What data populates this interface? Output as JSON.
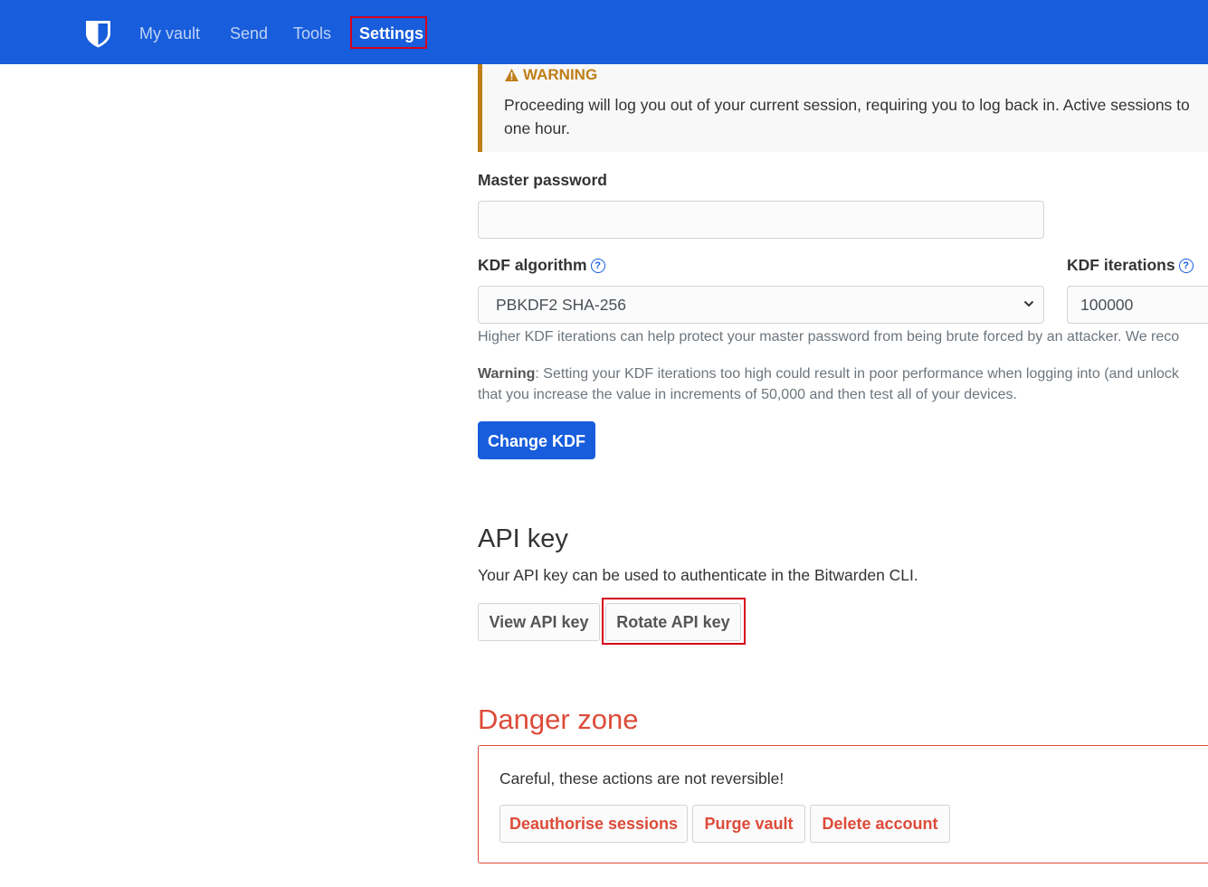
{
  "nav": {
    "items": [
      {
        "label": "My vault"
      },
      {
        "label": "Send"
      },
      {
        "label": "Tools"
      },
      {
        "label": "Settings",
        "active": true
      }
    ]
  },
  "warning": {
    "title": "WARNING",
    "text": "Proceeding will log you out of your current session, requiring you to log back in. Active sessions to one hour."
  },
  "master_password": {
    "label": "Master password",
    "value": ""
  },
  "kdf": {
    "algorithm_label": "KDF algorithm",
    "algorithm_value": "PBKDF2 SHA-256",
    "iterations_label": "KDF iterations",
    "iterations_value": "100000",
    "help_line": "Higher KDF iterations can help protect your master password from being brute forced by an attacker. We reco",
    "warning_label": "Warning",
    "warning_text_1": ": Setting your KDF iterations too high could result in poor performance when logging into (and unlock",
    "warning_text_2": "that you increase the value in increments of 50,000 and then test all of your devices.",
    "change_button": "Change KDF"
  },
  "api_key": {
    "heading": "API key",
    "description": "Your API key can be used to authenticate in the Bitwarden CLI.",
    "view_button": "View API key",
    "rotate_button": "Rotate API key"
  },
  "danger_zone": {
    "heading": "Danger zone",
    "text": "Careful, these actions are not reversible!",
    "deauthorise_button": "Deauthorise sessions",
    "purge_button": "Purge vault",
    "delete_button": "Delete account"
  },
  "colors": {
    "brand": "#175ddc",
    "warning": "#bf7e16",
    "danger": "#dd4b39",
    "highlight": "#d6001c"
  }
}
